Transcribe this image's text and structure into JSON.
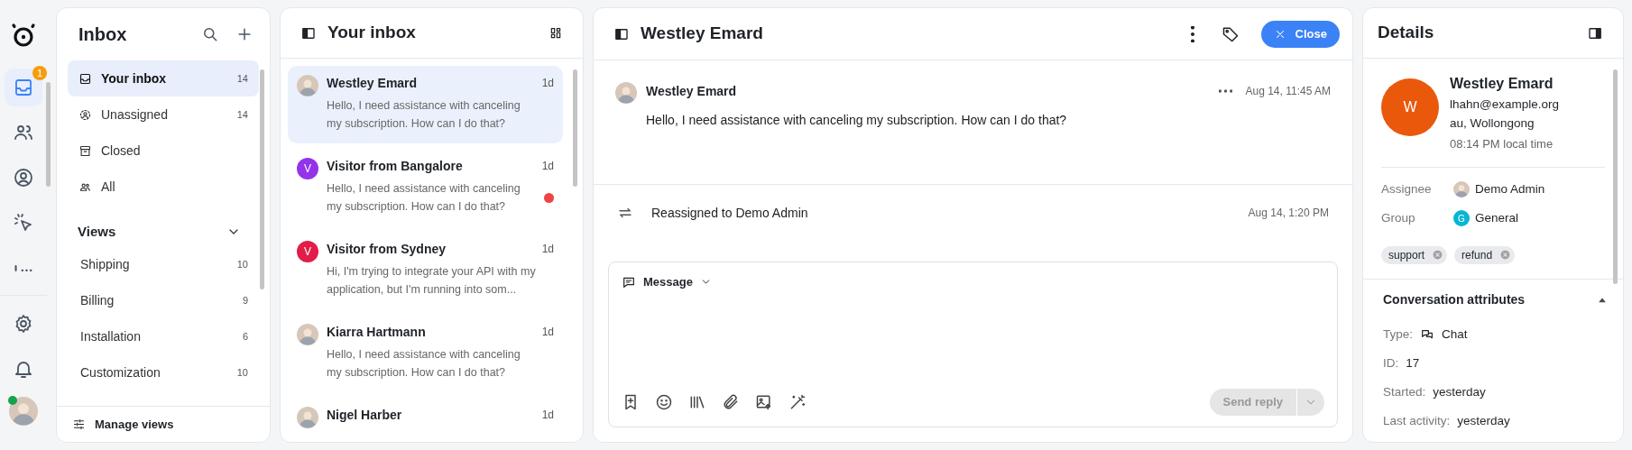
{
  "rail": {
    "top": [
      {
        "kind": "inbox",
        "selected": true,
        "badge": "1"
      },
      {
        "kind": "contacts",
        "selected": false
      },
      {
        "kind": "user",
        "selected": false
      },
      {
        "kind": "cursor",
        "selected": false
      },
      {
        "kind": "more",
        "selected": false
      }
    ],
    "bottom": [
      {
        "kind": "settings"
      },
      {
        "kind": "bell"
      }
    ],
    "user_online": true
  },
  "inbox_panel": {
    "title": "Inbox",
    "items": [
      {
        "kind": "inbox",
        "label": "Your inbox",
        "count": "14",
        "selected": true
      },
      {
        "kind": "unassigned",
        "label": "Unassigned",
        "count": "14",
        "selected": false
      },
      {
        "kind": "archive",
        "label": "Closed",
        "selected": false
      },
      {
        "kind": "all",
        "label": "All",
        "selected": false
      }
    ],
    "views": {
      "title": "Views",
      "expanded": true,
      "items": [
        {
          "label": "Shipping",
          "count": "10"
        },
        {
          "label": "Billing",
          "count": "9"
        },
        {
          "label": "Installation",
          "count": "6"
        },
        {
          "label": "Customization",
          "count": "10"
        }
      ]
    },
    "footer": "Manage views"
  },
  "conversations": {
    "title": "Your inbox",
    "items": [
      {
        "name": "Westley Emard",
        "time": "1d",
        "preview": "Hello, I need assistance with canceling my subscription. How can I do that?",
        "avatar": {
          "kind": "photo"
        },
        "selected": true,
        "unread": false
      },
      {
        "name": "Visitor from Bangalore",
        "time": "1d",
        "preview": "Hello, I need assistance with canceling my subscription. How can I do that?",
        "avatar": {
          "kind": "letter",
          "letter": "V",
          "color": "#9333ea"
        },
        "selected": false,
        "unread": true
      },
      {
        "name": "Visitor from Sydney",
        "time": "1d",
        "preview": "Hi, I'm trying to integrate your API with my application, but I'm running into som...",
        "avatar": {
          "kind": "letter",
          "letter": "V",
          "color": "#e11d48"
        },
        "selected": false,
        "unread": false
      },
      {
        "name": "Kiarra Hartmann",
        "time": "1d",
        "preview": "Hello, I need assistance with canceling my subscription. How can I do that?",
        "avatar": {
          "kind": "photo"
        },
        "selected": false,
        "unread": false
      },
      {
        "name": "Nigel Harber",
        "time": "1d",
        "avatar": {
          "kind": "photo"
        },
        "selected": false
      }
    ]
  },
  "conversation": {
    "title": "Westley Emard",
    "close_button": "Close",
    "message": {
      "author": "Westley Emard",
      "time": "Aug 14, 11:45 AM",
      "text": "Hello, I need assistance with canceling my subscription. How can I do that?"
    },
    "event": {
      "text": "Reassigned to Demo Admin",
      "time": "Aug 14, 1:20 PM"
    },
    "composer": {
      "mode": "Message",
      "send_button": "Send reply",
      "send_disabled": true
    }
  },
  "details": {
    "title": "Details",
    "contact": {
      "initial": "W",
      "name": "Westley Emard",
      "email": "lhahn@example.org",
      "location": "au, Wollongong",
      "local_time": "08:14 PM local time"
    },
    "assignee": {
      "label": "Assignee",
      "value": "Demo Admin"
    },
    "group": {
      "label": "Group",
      "value": "General",
      "initial": "G"
    },
    "tags": [
      "support",
      "refund"
    ],
    "attributes": {
      "title": "Conversation attributes",
      "expanded": true,
      "rows": [
        {
          "label": "Type:",
          "value": "Chat",
          "kind": "chat"
        },
        {
          "label": "ID:",
          "value": "17"
        },
        {
          "label": "Started:",
          "value": "yesterday"
        },
        {
          "label": "Last activity:",
          "value": "yesterday"
        }
      ]
    }
  }
}
